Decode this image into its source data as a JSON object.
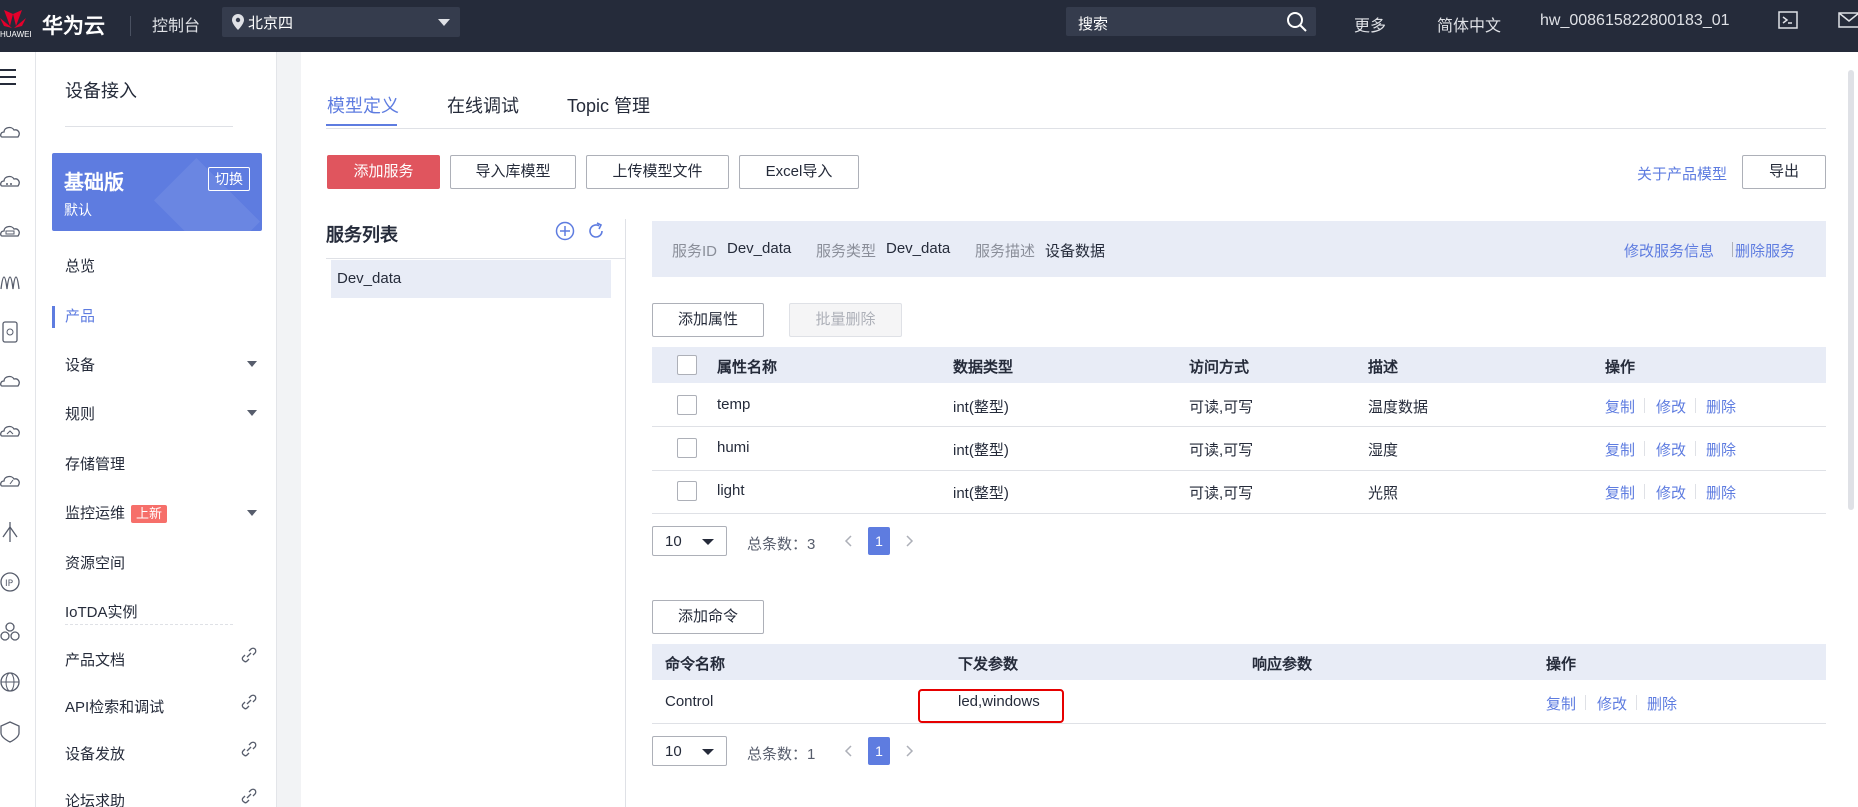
{
  "topbar": {
    "logo_text": "HUAWEI",
    "brand": "华为云",
    "console": "控制台",
    "region": "北京四",
    "search_placeholder": "搜索",
    "more": "更多",
    "language": "简体中文",
    "username": "hw_008615822800183_01"
  },
  "nav": {
    "title": "设备接入",
    "edition": {
      "name": "基础版",
      "switch": "切换",
      "default": "默认"
    },
    "items": [
      {
        "label": "总览"
      },
      {
        "label": "产品"
      },
      {
        "label": "设备"
      },
      {
        "label": "规则"
      },
      {
        "label": "存储管理"
      },
      {
        "label": "监控运维",
        "badge": "上新"
      },
      {
        "label": "资源空间"
      },
      {
        "label": "IoTDA实例"
      },
      {
        "label": "产品文档"
      },
      {
        "label": "API检索和调试"
      },
      {
        "label": "设备发放"
      },
      {
        "label": "论坛求助"
      }
    ]
  },
  "tabs": [
    {
      "label": "模型定义"
    },
    {
      "label": "在线调试"
    },
    {
      "label": "Topic 管理"
    }
  ],
  "toolbar": {
    "add_service": "添加服务",
    "import_library": "导入库模型",
    "upload_model": "上传模型文件",
    "excel_import": "Excel导入",
    "about_model": "关于产品模型",
    "export": "导出"
  },
  "services": {
    "title": "服务列表",
    "items": [
      "Dev_data"
    ]
  },
  "service_info": {
    "id_label": "服务ID",
    "id_value": "Dev_data",
    "type_label": "服务类型",
    "type_value": "Dev_data",
    "desc_label": "服务描述",
    "desc_value": "设备数据",
    "edit": "修改服务信息",
    "delete": "删除服务"
  },
  "properties": {
    "add": "添加属性",
    "batch_delete": "批量删除",
    "headers": [
      "属性名称",
      "数据类型",
      "访问方式",
      "描述",
      "操作"
    ],
    "rows": [
      {
        "name": "temp",
        "type": "int(整型)",
        "access": "可读,可写",
        "desc": "温度数据"
      },
      {
        "name": "humi",
        "type": "int(整型)",
        "access": "可读,可写",
        "desc": "湿度"
      },
      {
        "name": "light",
        "type": "int(整型)",
        "access": "可读,可写",
        "desc": "光照"
      }
    ],
    "actions": [
      "复制",
      "修改",
      "删除"
    ],
    "pagination": {
      "size": "10",
      "total": "总条数：3",
      "page": "1"
    }
  },
  "commands": {
    "add": "添加命令",
    "headers": [
      "命令名称",
      "下发参数",
      "响应参数",
      "操作"
    ],
    "rows": [
      {
        "name": "Control",
        "params": "led,windows",
        "response": ""
      }
    ],
    "actions": [
      "复制",
      "修改",
      "删除"
    ],
    "pagination": {
      "size": "10",
      "total": "总条数：1",
      "page": "1"
    }
  },
  "colors": {
    "accent": "#5e7ce0",
    "danger": "#e0555e",
    "topbar": "#252b3a",
    "highlight": "#e60000"
  }
}
